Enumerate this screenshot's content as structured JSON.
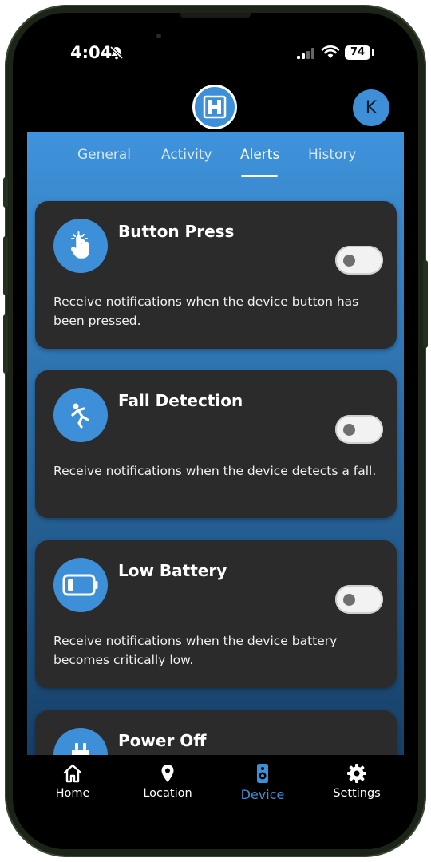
{
  "status_bar": {
    "time": "4:04",
    "battery": "74"
  },
  "header": {
    "avatar_initial": "K"
  },
  "tabs": [
    {
      "label": "General"
    },
    {
      "label": "Activity"
    },
    {
      "label": "Alerts"
    },
    {
      "label": "History"
    }
  ],
  "active_tab": "Alerts",
  "alerts": [
    {
      "title": "Button Press",
      "description": "Receive notifications when the device button has been pressed.",
      "enabled": false
    },
    {
      "title": "Fall Detection",
      "description": "Receive notifications when the device detects a fall.",
      "enabled": false
    },
    {
      "title": "Low Battery",
      "description": "Receive notifications when the device battery becomes critically low.",
      "enabled": false
    },
    {
      "title": "Power Off",
      "description": "",
      "enabled": false
    }
  ],
  "bottom_nav": [
    {
      "label": "Home",
      "icon": "home-icon"
    },
    {
      "label": "Location",
      "icon": "location-pin-icon"
    },
    {
      "label": "Device",
      "icon": "device-icon"
    },
    {
      "label": "Settings",
      "icon": "gear-icon"
    }
  ],
  "active_nav": "Device",
  "colors": {
    "accent": "#3d8fd8",
    "card": "#2b2b2b"
  }
}
